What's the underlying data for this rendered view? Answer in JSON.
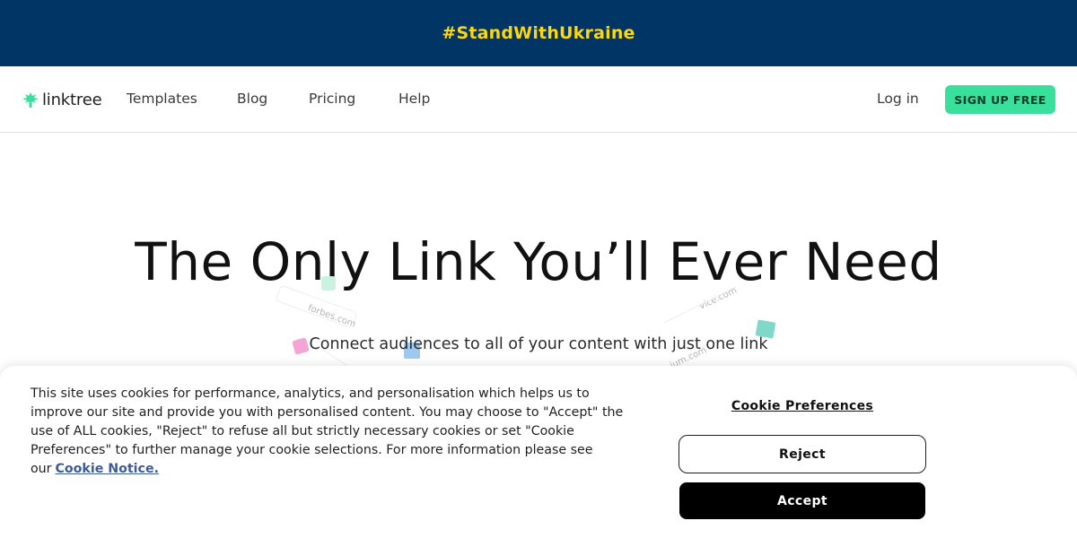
{
  "banner": {
    "text": "#StandWithUkraine",
    "color": "#ffd60a",
    "background": "#003566"
  },
  "nav": {
    "logo_text": "linktree",
    "logo_icon": "linktree-logo-icon",
    "links": [
      "Templates",
      "Blog",
      "Pricing",
      "Help"
    ],
    "login": "Log in",
    "signup": "SIGN UP FREE",
    "accent": "#39e09b"
  },
  "hero": {
    "title": "The Only Link You’ll Ever Need",
    "subtitle": "Connect audiences to all of your content with just one link",
    "decorations": [
      "forbes.com",
      "vice.com",
      "ium.com"
    ]
  },
  "cookie": {
    "text": "This site uses cookies for performance, analytics, and personalisation which helps us to improve our site and provide you with personalised content. You may choose to \"Accept\" the use of ALL cookies, \"Reject\" to refuse all but strictly necessary cookies or set \"Cookie Preferences\" to further manage your cookie selections. For more information please see our",
    "notice_link": "Cookie Notice.",
    "preferences": "Cookie Preferences",
    "reject": "Reject",
    "accept": "Accept"
  }
}
